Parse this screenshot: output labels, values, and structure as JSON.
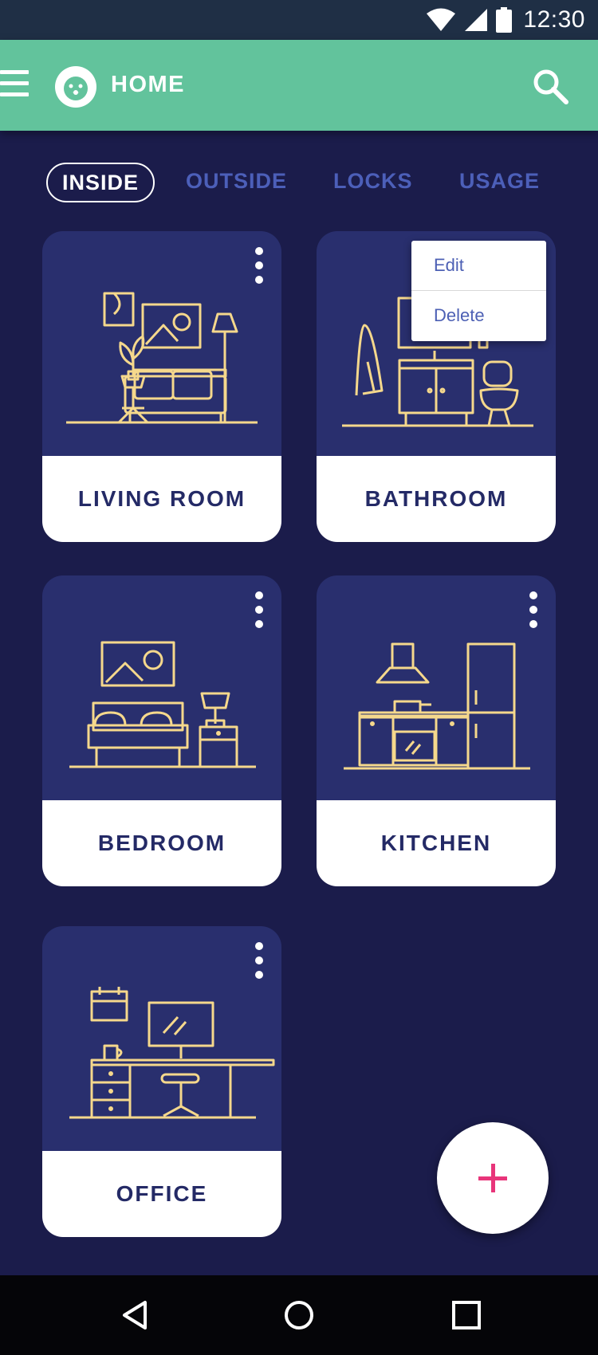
{
  "status_bar": {
    "time": "12:30",
    "icons": [
      "wifi-icon",
      "cell-signal-icon",
      "battery-icon"
    ]
  },
  "app_bar": {
    "title": "HOME",
    "icons": [
      "menu-icon",
      "lion-logo-icon",
      "search-icon"
    ]
  },
  "tabs": [
    {
      "label": "INSIDE",
      "selected": true
    },
    {
      "label": "OUTSIDE",
      "selected": false
    },
    {
      "label": "LOCKS",
      "selected": false
    },
    {
      "label": "USAGE",
      "selected": false
    }
  ],
  "rooms": [
    {
      "name": "LIVING ROOM",
      "icon": "living-room-illustration"
    },
    {
      "name": "BATHROOM",
      "icon": "bathroom-illustration"
    },
    {
      "name": "BEDROOM",
      "icon": "bedroom-illustration"
    },
    {
      "name": "KITCHEN",
      "icon": "kitchen-illustration"
    },
    {
      "name": "OFFICE",
      "icon": "office-illustration"
    }
  ],
  "context_menu": {
    "open_on": "BATHROOM",
    "items": [
      "Edit",
      "Delete"
    ]
  },
  "fab": {
    "icon": "plus-icon"
  },
  "nav_bar": {
    "icons": [
      "back-icon",
      "home-icon",
      "recents-icon"
    ]
  },
  "colors": {
    "background": "#1b1c4b",
    "app_bar": "#62c39c",
    "card_art": "#292f6e",
    "illustration_line": "#f5d88c",
    "tab_inactive": "#4c5fb9",
    "fab_plus": "#e8357a"
  }
}
